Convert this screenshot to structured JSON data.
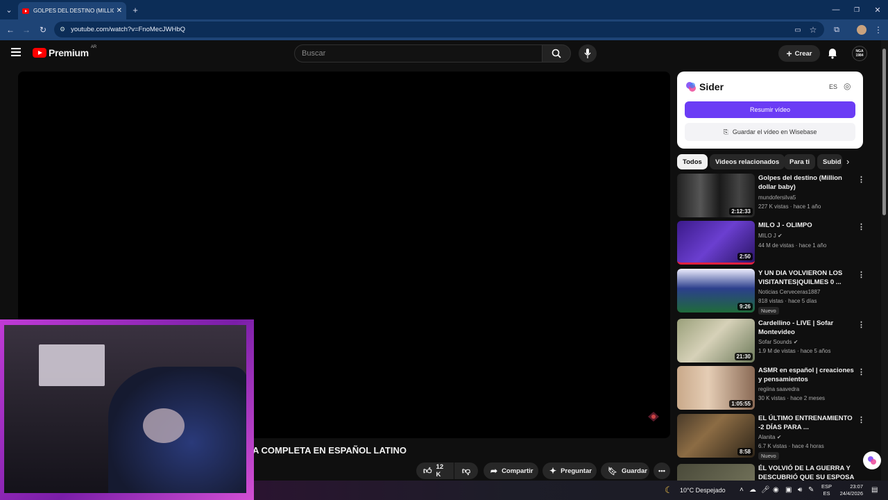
{
  "browser": {
    "tab_title": "GOLPES DEL DESTINO (MILLION",
    "url": "youtube.com/watch?v=FnoMecJWHbQ"
  },
  "yt": {
    "logo_text": "Premium",
    "region": "AR",
    "search_placeholder": "Buscar",
    "create_label": "Crear",
    "avatar_text": "NGA 1984"
  },
  "video": {
    "title": "A COMPLETA EN ESPAÑOL LATINO",
    "likes": "12 K",
    "share_label": "Compartir",
    "ask_label": "Preguntar",
    "save_label": "Guardar"
  },
  "sider": {
    "brand": "Sider",
    "lang": "ES",
    "summarize_label": "Resumir vídeo",
    "wisebase_label": "Guardar el vídeo en Wisebase"
  },
  "chips": [
    "Todos",
    "Videos relacionados",
    "Para ti",
    "Subid"
  ],
  "recommendations": [
    {
      "title": "Golpes del destino (Million dollar baby)",
      "channel": "mundofersilva5",
      "meta": "227 K vistas · hace 1 año",
      "duration": "2:12:33",
      "badge": "",
      "verified": false
    },
    {
      "title": "MILO J - OLIMPO",
      "channel": "MILO J",
      "meta": "44 M de vistas · hace 1 año",
      "duration": "2:50",
      "badge": "",
      "verified": true
    },
    {
      "title": "Y UN DIA VOLVIERON LOS VISITANTES|QUILMES 0 ...",
      "channel": "Noticias Cerveceras1887",
      "meta": "818 vistas · hace 5 días",
      "duration": "9:26",
      "badge": "Nuevo",
      "verified": false
    },
    {
      "title": "Cardellino - LIVE | Sofar Montevideo",
      "channel": "Sofar Sounds",
      "meta": "1.9 M de vistas · hace 5 años",
      "duration": "21:30",
      "badge": "",
      "verified": true
    },
    {
      "title": "ASMR en español | creaciones y pensamientos",
      "channel": "regiina saavedra",
      "meta": "30 K vistas · hace 2 meses",
      "duration": "1:05:55",
      "badge": "",
      "verified": false
    },
    {
      "title": "EL ÚLTIMO ENTRENAMIENTO -2 DÍAS PARA ...",
      "channel": "Alanita",
      "meta": "6.7 K vistas · hace 4 horas",
      "duration": "8:58",
      "badge": "Nuevo",
      "verified": true
    },
    {
      "title": "ÉL VOLVIÓ DE LA GUERRA Y DESCUBRIÓ QUE SU ESPOSA ...",
      "channel": "",
      "meta": "",
      "duration": "",
      "badge": "",
      "verified": false
    }
  ],
  "taskbar": {
    "weather": "10°C  Despejado",
    "lang_top": "ESP",
    "lang_bottom": "ES",
    "time": "23:07",
    "date": "24/4/2026"
  }
}
